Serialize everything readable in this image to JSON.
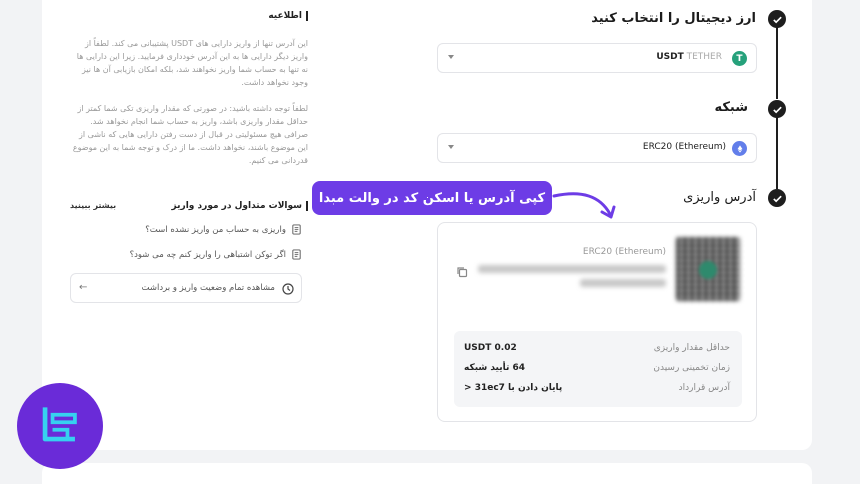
{
  "steps": {
    "currency": {
      "title": "ارز دیجیتال را انتخاب کنید",
      "symbol": "USDT",
      "name": "TETHER",
      "coin_letter": "T",
      "coin_color": "#26a17b"
    },
    "network": {
      "title": "شبکه",
      "value": "ERC20 (Ethereum)",
      "coin_color": "#627eea"
    },
    "address": {
      "title": "آدرس واریزی",
      "network_label": "ERC20 (Ethereum)"
    }
  },
  "deposit_info": {
    "min_label": "حداقل مقدار واریزی",
    "min_value": "USDT 0.02",
    "time_label": "زمان تخمینی رسیدن",
    "time_value": "64 تأیید شبکه",
    "contract_label": "آدرس قرارداد",
    "contract_value": "پایان دادن با  31ec7"
  },
  "callout": "کپی آدرس یا اسکن کد در والت مبدا",
  "notice": {
    "title": "اطلاعیه",
    "p1": "این آدرس تنها از واریز دارایی های USDT پشتیبانی می کند. لطفاً از واریز دیگر دارایی ها به این آدرس خودداری فرمایید. زیرا این دارایی ها نه تنها به حساب شما واریز نخواهند شد، بلکه امکان بازیابی آن ها نیز وجود نخواهد داشت.",
    "p2": "لطفاً توجه داشته باشید: در صورتی که مقدار واریزی تکی شما کمتر از حداقل مقدار واریزی باشد، واریز به حساب شما انجام نخواهد شد. صرافی هیچ مسئولیتی در قبال از دست رفتن دارایی هایی که ناشی از این موضوع باشند، نخواهد داشت. ما از درک و توجه شما به این موضوع قدردانی می کنیم."
  },
  "faq": {
    "title": "سوالات متداول در مورد واریز",
    "more": "بیشتر ببینید",
    "items": [
      "واریزی به حساب من واریز نشده است؟",
      "اگر توکن اشتباهی را واریز کنم چه می شود؟"
    ],
    "status_button": "مشاهده تمام وضعیت واریز و برداشت"
  },
  "colors": {
    "accent": "#6d3ce6",
    "logo_bg": "#6a2bd8",
    "logo_stroke": "#36d1f0"
  }
}
